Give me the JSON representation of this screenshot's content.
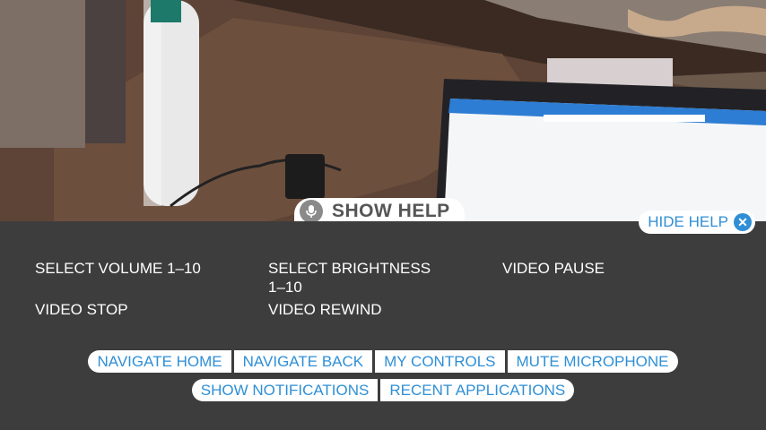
{
  "help": {
    "show_label": "SHOW HELP",
    "hide_label": "HIDE HELP"
  },
  "commands": [
    "SELECT VOLUME 1–10",
    "SELECT BRIGHTNESS 1–10",
    "VIDEO PAUSE",
    "VIDEO STOP",
    "VIDEO REWIND"
  ],
  "nav_row1": [
    "NAVIGATE HOME",
    "NAVIGATE BACK",
    "MY CONTROLS",
    "MUTE MICROPHONE"
  ],
  "nav_row2": [
    "SHOW NOTIFICATIONS",
    "RECENT APPLICATIONS"
  ],
  "icons": {
    "microphone": "microphone-icon",
    "close": "close-icon"
  },
  "colors": {
    "accent": "#2f8fd6",
    "panel": "#3d3d3d",
    "text": "#ffffff"
  }
}
